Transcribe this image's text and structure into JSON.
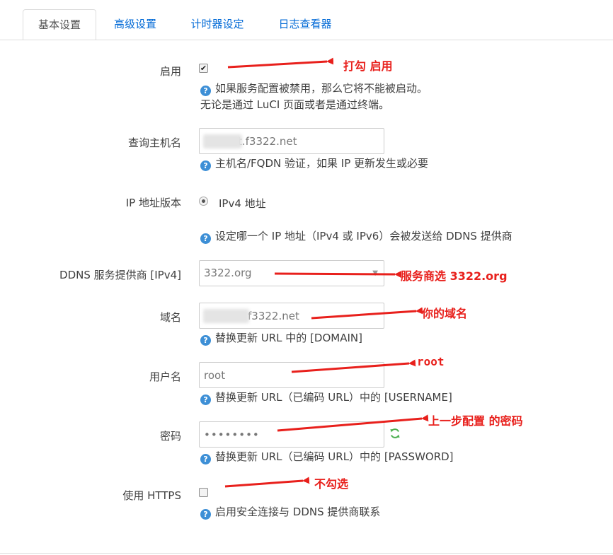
{
  "tabs": [
    {
      "label": "基本设置",
      "active": true
    },
    {
      "label": "高级设置",
      "active": false
    },
    {
      "label": "计时器设定",
      "active": false
    },
    {
      "label": "日志查看器",
      "active": false
    }
  ],
  "form": {
    "enable": {
      "label": "启用",
      "checked": true,
      "hint_line1": "如果服务配置被禁用，那么它将不能被启动。",
      "hint_line2": "无论是通过 LuCI 页面或者是通过终端。"
    },
    "lookup_host": {
      "label": "查询主机名",
      "value": "t.f3322.net",
      "hint": "主机名/FQDN 验证，如果 IP 更新发生或必要"
    },
    "ip_version": {
      "label": "IP 地址版本",
      "option": "IPv4 地址",
      "hint": "设定哪一个 IP 地址（IPv4 或 IPv6）会被发送给 DDNS 提供商"
    },
    "service": {
      "label": "DDNS 服务提供商 [IPv4]",
      "value": "3322.org"
    },
    "domain": {
      "label": "域名",
      "value": "f3322.net",
      "hint": "替换更新 URL 中的 [DOMAIN]"
    },
    "username": {
      "label": "用户名",
      "value": "root",
      "hint": "替换更新 URL（已编码 URL）中的 [USERNAME]"
    },
    "password": {
      "label": "密码",
      "value": "••••••••",
      "hint": "替换更新 URL（已编码 URL）中的 [PASSWORD]"
    },
    "https": {
      "label": "使用 HTTPS",
      "checked": false,
      "hint": "启用安全连接与 DDNS 提供商联系"
    }
  },
  "annotations": {
    "enable": "打勾  启用",
    "service": "服务商选  3322.org",
    "domain": "你的域名",
    "username": "root",
    "password": "上一步配置  的密码",
    "https": "不勾选"
  },
  "help_glyph": "?",
  "check_glyph": "✔",
  "caret_glyph": "▼",
  "colors": {
    "tab_link": "#0069d6",
    "help_icon": "#3d8fd6",
    "annotation": "#e8201c",
    "refresh_icon": "#4caf50"
  }
}
